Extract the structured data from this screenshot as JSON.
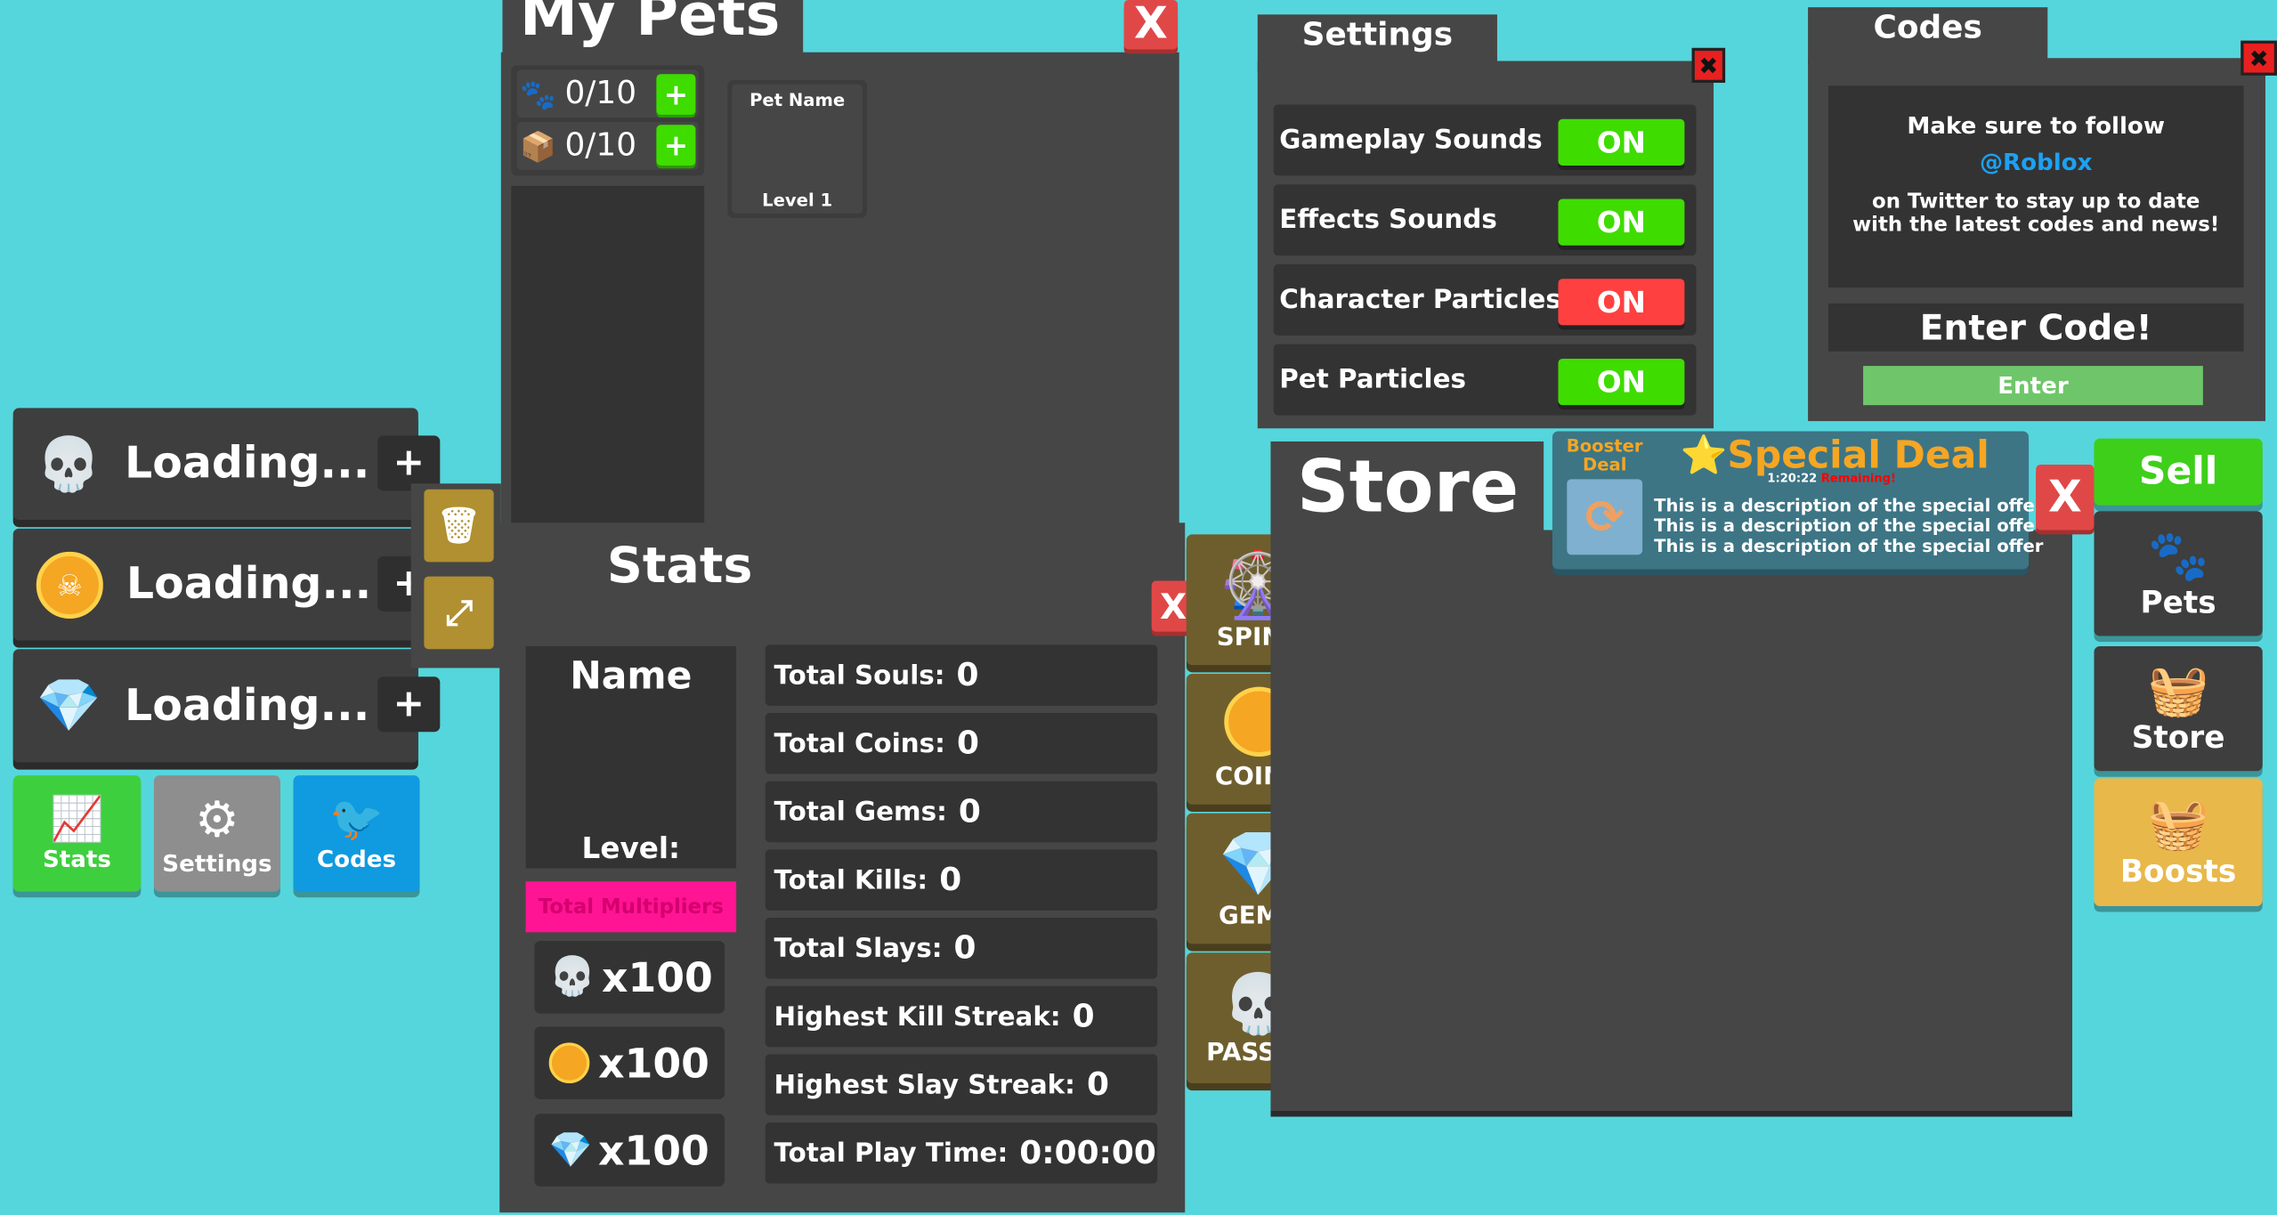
{
  "colors": {
    "background": "#55d6dc",
    "panel": "#464646",
    "green": "#3fdc00",
    "red": "#ff4040",
    "pink": "#ff1493",
    "gold": "#e8b84a",
    "twitter": "#1da1f2"
  },
  "resources": [
    {
      "icon": "skull-icon",
      "text": "Loading...",
      "plus": "+"
    },
    {
      "icon": "coin-icon",
      "text": "Loading...",
      "plus": "+"
    },
    {
      "icon": "gem-icon",
      "text": "Loading...",
      "plus": "+"
    }
  ],
  "bottom_buttons": [
    {
      "label": "Stats",
      "icon": "chart-icon"
    },
    {
      "label": "Settings",
      "icon": "gear-icon"
    },
    {
      "label": "Codes",
      "icon": "twitter-icon"
    }
  ],
  "pets": {
    "title": "My Pets",
    "close": "X",
    "counters": [
      {
        "icon": "paw-icon",
        "value": "0/10"
      },
      {
        "icon": "box-icon",
        "value": "0/10"
      }
    ],
    "add": "+",
    "card": {
      "name": "Pet Name",
      "level": "Level 1"
    }
  },
  "stats": {
    "title": "Stats",
    "name": "Name",
    "level": "Level:",
    "multipliers_label": "Total Multipliers",
    "multipliers": [
      {
        "icon": "skull-icon",
        "value": "x100"
      },
      {
        "icon": "coin-icon",
        "value": "x100"
      },
      {
        "icon": "gem-icon",
        "value": "x100"
      }
    ],
    "rows": [
      {
        "label": "Total Souls:",
        "value": "0"
      },
      {
        "label": "Total Coins:",
        "value": "0"
      },
      {
        "label": "Total Gems:",
        "value": "0"
      },
      {
        "label": "Total Kills:",
        "value": "0"
      },
      {
        "label": "Total Slays:",
        "value": "0"
      },
      {
        "label": "Highest Kill Streak:",
        "value": "0"
      },
      {
        "label": "Highest Slay Streak:",
        "value": "0"
      },
      {
        "label": "Total Play Time:",
        "value": "0:00:00"
      }
    ]
  },
  "side_buttons": [
    {
      "label": "SPINS",
      "icon": "wheel-icon"
    },
    {
      "label": "COINS",
      "icon": "coin-icon"
    },
    {
      "label": "GEMS",
      "icon": "gem-icon"
    },
    {
      "label": "PASSES",
      "icon": "pass-icon"
    }
  ],
  "settings": {
    "title": "Settings",
    "rows": [
      {
        "label": "Gameplay Sounds",
        "state": "ON",
        "color": "#3fdc00"
      },
      {
        "label": "Effects Sounds",
        "state": "ON",
        "color": "#3fdc00"
      },
      {
        "label": "Character Particles",
        "state": "ON",
        "color": "#ff4040"
      },
      {
        "label": "Pet Particles",
        "state": "ON",
        "color": "#3fdc00"
      }
    ]
  },
  "codes": {
    "title": "Codes",
    "line1": "Make sure to follow",
    "handle": "@Roblox",
    "line2": "on Twitter to stay up to date with the latest codes and news!",
    "input_placeholder": "Enter Code!",
    "enter": "Enter"
  },
  "store": {
    "title": "Store"
  },
  "deal": {
    "booster": "Booster Deal",
    "title": "Special Deal",
    "timer": "1:20:22",
    "remaining": "Remaining!",
    "desc": [
      "This is a description of the special offer",
      "This is a description of the special offer",
      "This is a description of the special offer"
    ]
  },
  "right_buttons": [
    {
      "label": "Sell"
    },
    {
      "label": "Pets",
      "icon": "paw-icon"
    },
    {
      "label": "Store",
      "icon": "basket-icon"
    },
    {
      "label": "Boosts",
      "icon": "boost-basket-icon"
    }
  ]
}
